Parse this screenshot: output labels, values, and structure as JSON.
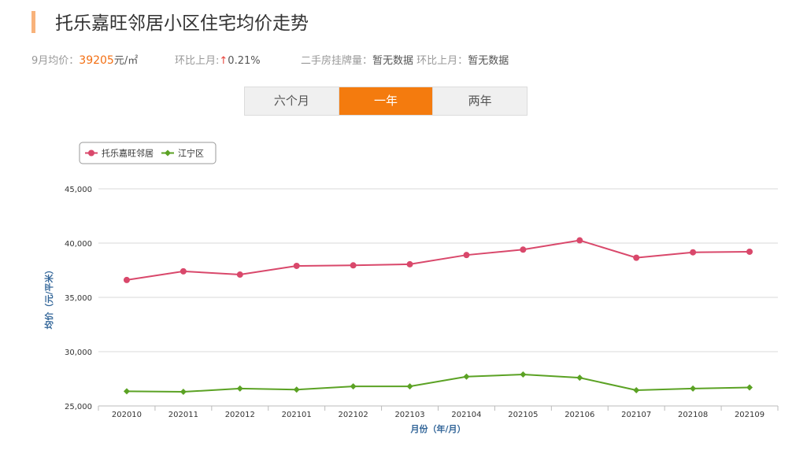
{
  "header": {
    "title": "托乐嘉旺邻居小区住宅均价走势"
  },
  "stats": {
    "price_label": "9月均价：",
    "price_value": "39205",
    "price_unit": "元/㎡",
    "mom_label": "环比上月:",
    "mom_arrow": "↑",
    "mom_value": "0.21%",
    "listing_label": "二手房挂牌量：",
    "listing_value": "暂无数据",
    "listing_mom_label": "环比上月：",
    "listing_mom_value": "暂无数据"
  },
  "tabs": [
    {
      "label": "六个月",
      "active": false
    },
    {
      "label": "一年",
      "active": true
    },
    {
      "label": "两年",
      "active": false
    }
  ],
  "chart_data": {
    "type": "line",
    "categories": [
      "202010",
      "202011",
      "202012",
      "202101",
      "202102",
      "202103",
      "202104",
      "202105",
      "202106",
      "202107",
      "202108",
      "202109"
    ],
    "series": [
      {
        "name": "托乐嘉旺邻居",
        "color": "#d9486b",
        "marker": "circle",
        "values": [
          36600,
          37400,
          37100,
          37900,
          37950,
          38050,
          38900,
          39400,
          40250,
          38650,
          39150,
          39205
        ]
      },
      {
        "name": "江宁区",
        "color": "#5ba224",
        "marker": "diamond",
        "values": [
          26350,
          26300,
          26600,
          26500,
          26800,
          26800,
          27700,
          27900,
          27600,
          26450,
          26600,
          26700
        ]
      }
    ],
    "yticks": [
      "25,000",
      "30,000",
      "35,000",
      "40,000",
      "45,000"
    ],
    "ytick_values": [
      25000,
      30000,
      35000,
      40000,
      45000
    ],
    "ylim": [
      25000,
      45000
    ],
    "xlabel": "月份（年/月）",
    "ylabel": "均价（元/平米）",
    "grid": true,
    "legend_position": "top-left"
  }
}
